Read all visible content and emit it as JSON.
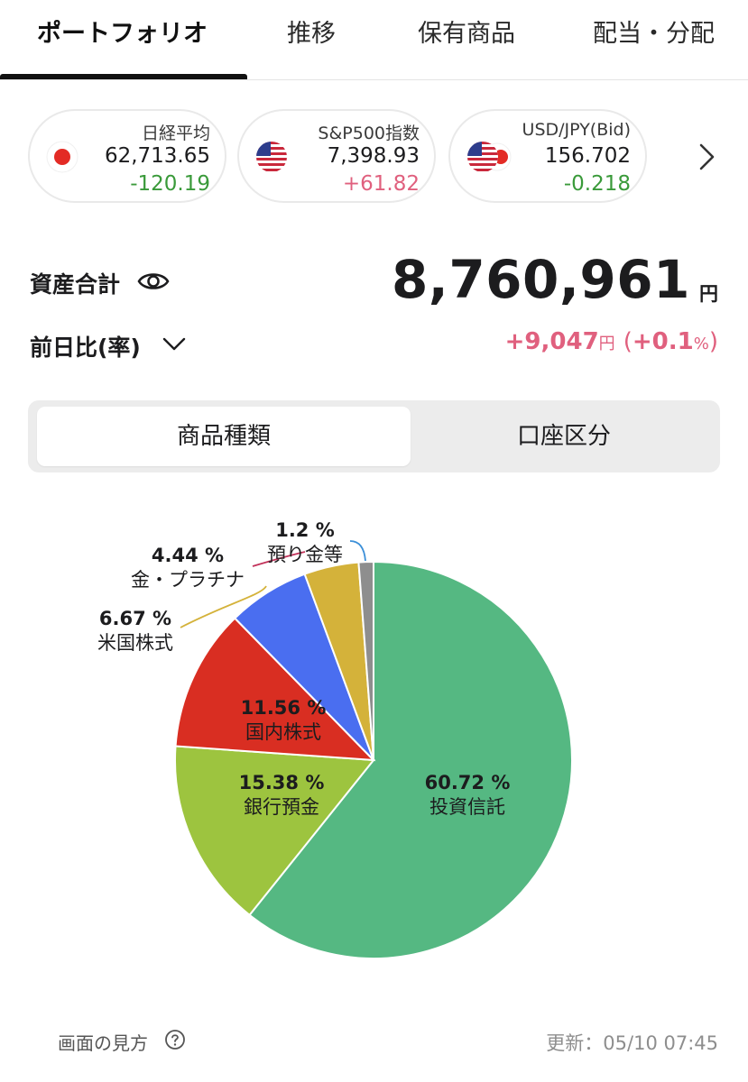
{
  "tabs": [
    {
      "label": "ポートフォリオ",
      "active": true
    },
    {
      "label": "推移",
      "active": false
    },
    {
      "label": "保有商品",
      "active": false
    },
    {
      "label": "配当・分配",
      "active": false
    }
  ],
  "markets": [
    {
      "name": "日経平均",
      "value": "62,713.65",
      "change": "-120.19",
      "change_color": "#3a9a3a",
      "flag": "japan-flag-icon"
    },
    {
      "name": "S&P500指数",
      "value": "7,398.93",
      "change": "+61.82",
      "change_color": "#e0607e",
      "flag": "usa-flag-icon"
    },
    {
      "name": "USD/JPY(Bid)",
      "value": "156.702",
      "change": "-0.218",
      "change_color": "#3a9a3a",
      "flag": "usa-japan-flag-icon"
    }
  ],
  "summary": {
    "total_label": "資産合計",
    "total_value": "8,760,961",
    "total_unit": "円",
    "diff_label": "前日比(率)",
    "diff_value": "+9,047",
    "diff_unit": "円",
    "diff_open": "(",
    "diff_pct": "+0.1",
    "diff_pct_unit": "%",
    "diff_close": ")",
    "positive_color": "#e0607e"
  },
  "segments": {
    "active": "商品種類",
    "inactive": "口座区分"
  },
  "chart_data": {
    "type": "pie",
    "slices": [
      {
        "label": "投資信託",
        "value": 60.72,
        "display": "60.72 %",
        "color": "#55b882"
      },
      {
        "label": "銀行預金",
        "value": 15.38,
        "display": "15.38 %",
        "color": "#9dc43f"
      },
      {
        "label": "国内株式",
        "value": 11.56,
        "display": "11.56 %",
        "color": "#d92e22"
      },
      {
        "label": "米国株式",
        "value": 6.67,
        "display": "6.67 %",
        "color": "#4a6ef0"
      },
      {
        "label": "金・プラチナ",
        "value": 4.44,
        "display": "4.44 %",
        "color": "#d4b23a"
      },
      {
        "label": "預り金等",
        "value": 1.2,
        "display": "1.2 %",
        "color": "#8e8e8e"
      }
    ]
  },
  "footer": {
    "help_label": "画面の見方",
    "updated": "更新：05/10 07:45"
  }
}
